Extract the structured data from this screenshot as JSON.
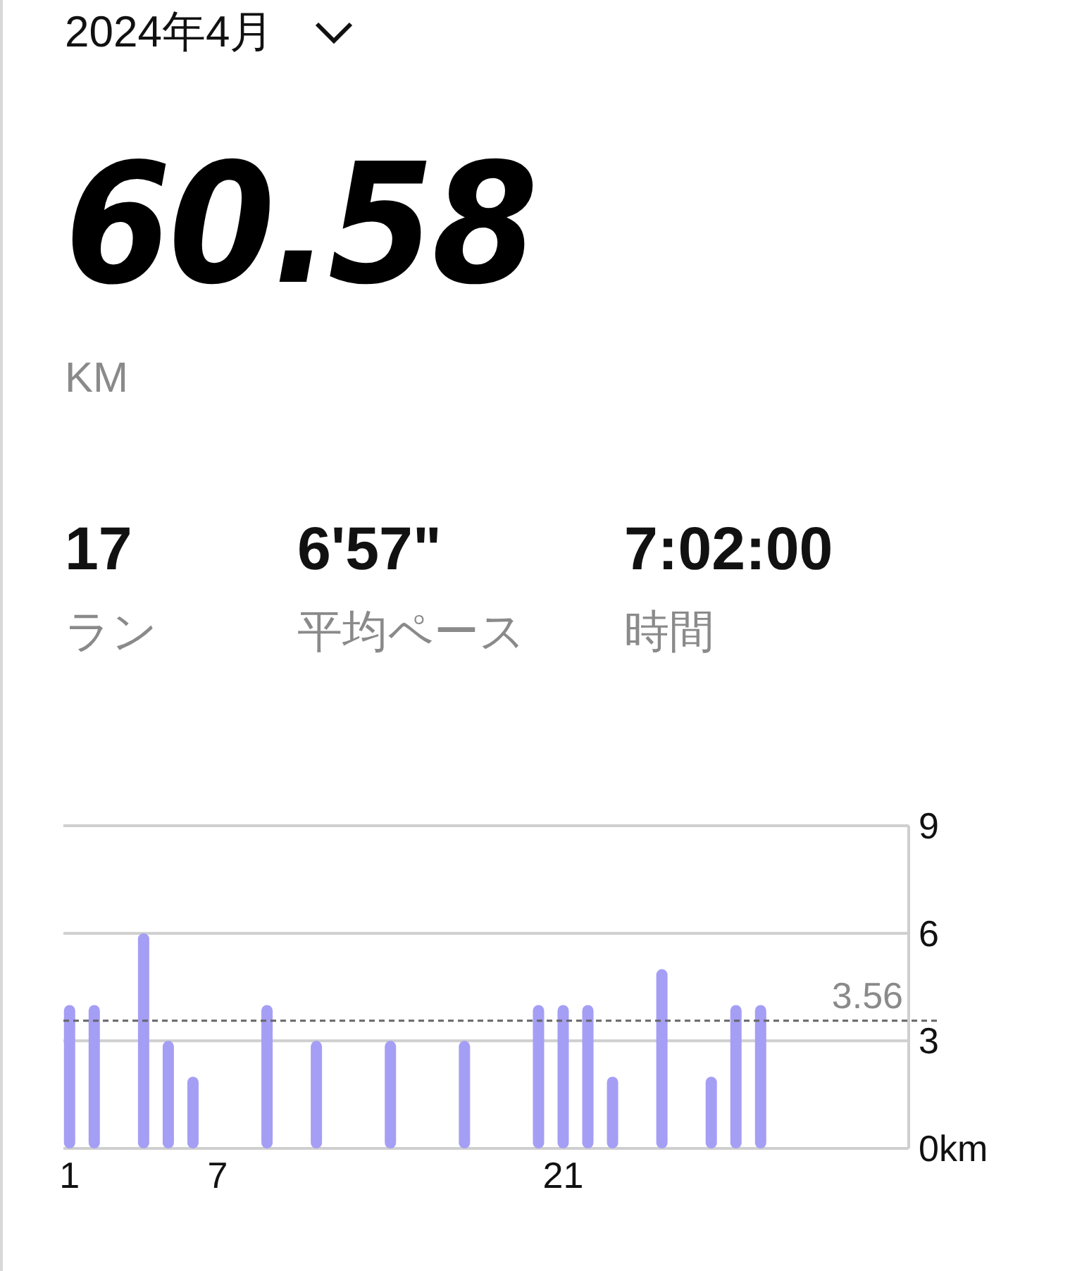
{
  "header": {
    "month": "2024年4月"
  },
  "total": {
    "value": "60.58",
    "unit": "KM"
  },
  "stats": [
    {
      "value": "17",
      "label": "ラン"
    },
    {
      "value": "6'57\"",
      "label": "平均ペース"
    },
    {
      "value": "7:02:00",
      "label": "時間"
    }
  ],
  "chart_data": {
    "type": "bar",
    "x": [
      1,
      2,
      4,
      5,
      6,
      9,
      11,
      14,
      17,
      20,
      21,
      22,
      23,
      25,
      27,
      28,
      29
    ],
    "series": [
      {
        "color": "#a59ef5",
        "values": [
          4,
          4,
          6,
          3,
          2,
          4,
          3,
          3,
          3,
          4,
          4,
          4,
          2,
          5,
          2,
          4,
          4
        ]
      }
    ],
    "xlim": [
      0.75,
      35
    ],
    "ylim": [
      0,
      9
    ],
    "yticks": [
      {
        "value": 0,
        "label": "0km"
      },
      3,
      6,
      9
    ],
    "xticks": [
      1,
      7,
      21
    ],
    "ref_lines": [
      {
        "axis": "y",
        "value": 3.56,
        "label": "3.56"
      }
    ]
  }
}
